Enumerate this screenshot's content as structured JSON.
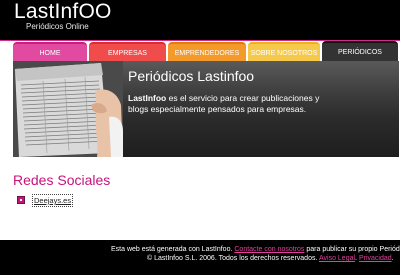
{
  "header": {
    "logo_title": "LastInfOO",
    "logo_subtitle": "Periódicos Online"
  },
  "tabs": [
    {
      "label": "HOME",
      "color": "#e14aa0"
    },
    {
      "label": "EMPRESAS",
      "color": "#f04c4c"
    },
    {
      "label": "EMPRENDEDORES",
      "color": "#f49a2a"
    },
    {
      "label": "SOBRE NOSOTROS",
      "color": "#f6c94a"
    },
    {
      "label": "PERIÓDICOS",
      "color": "#333333",
      "active": true
    }
  ],
  "banner": {
    "title": "Periódicos Lastinfoo",
    "brand": "LastInfoo",
    "text": " es el servicio para crear publicaciones y blogs especialmente pensados para empresas."
  },
  "section": {
    "title": "Redes Sociales",
    "items": [
      {
        "label": "Deejays.es"
      }
    ]
  },
  "footer": {
    "line1_prefix": "Esta web está generada con LastInfoo. ",
    "line1_link": "Contacte con nosotros",
    "line1_suffix": " para publicar su propio Periód",
    "line2_prefix": "© LastInfoo S.L. 2006. Todos los derechos reservados. ",
    "line2_link1": "Aviso Legal",
    "line2_sep": ". ",
    "line2_link2": "Privacidad",
    "line2_end": "."
  },
  "colors": {
    "accent": "#c5137d",
    "footer_link": "#e0409b"
  }
}
